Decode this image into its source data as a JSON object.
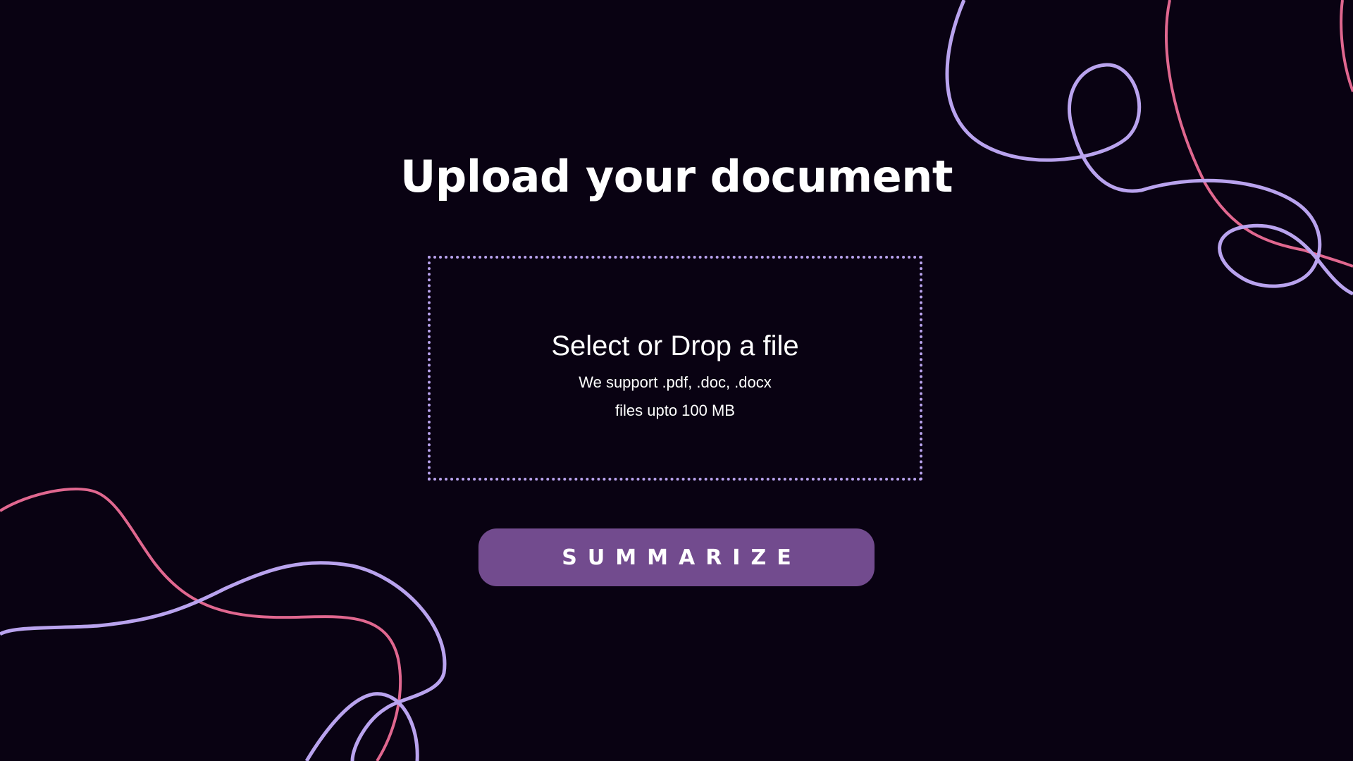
{
  "page": {
    "title": "Upload your document"
  },
  "dropzone": {
    "primary": "Select or Drop a file",
    "formats": "We support .pdf, .doc, .docx",
    "limit": "files upto 100 MB"
  },
  "actions": {
    "summarize_label": "SUMMARIZE"
  },
  "colors": {
    "background": "#090212",
    "accent_purple": "#724b8e",
    "line_lavender": "#b9a3ee",
    "line_pink": "#e0678f"
  }
}
